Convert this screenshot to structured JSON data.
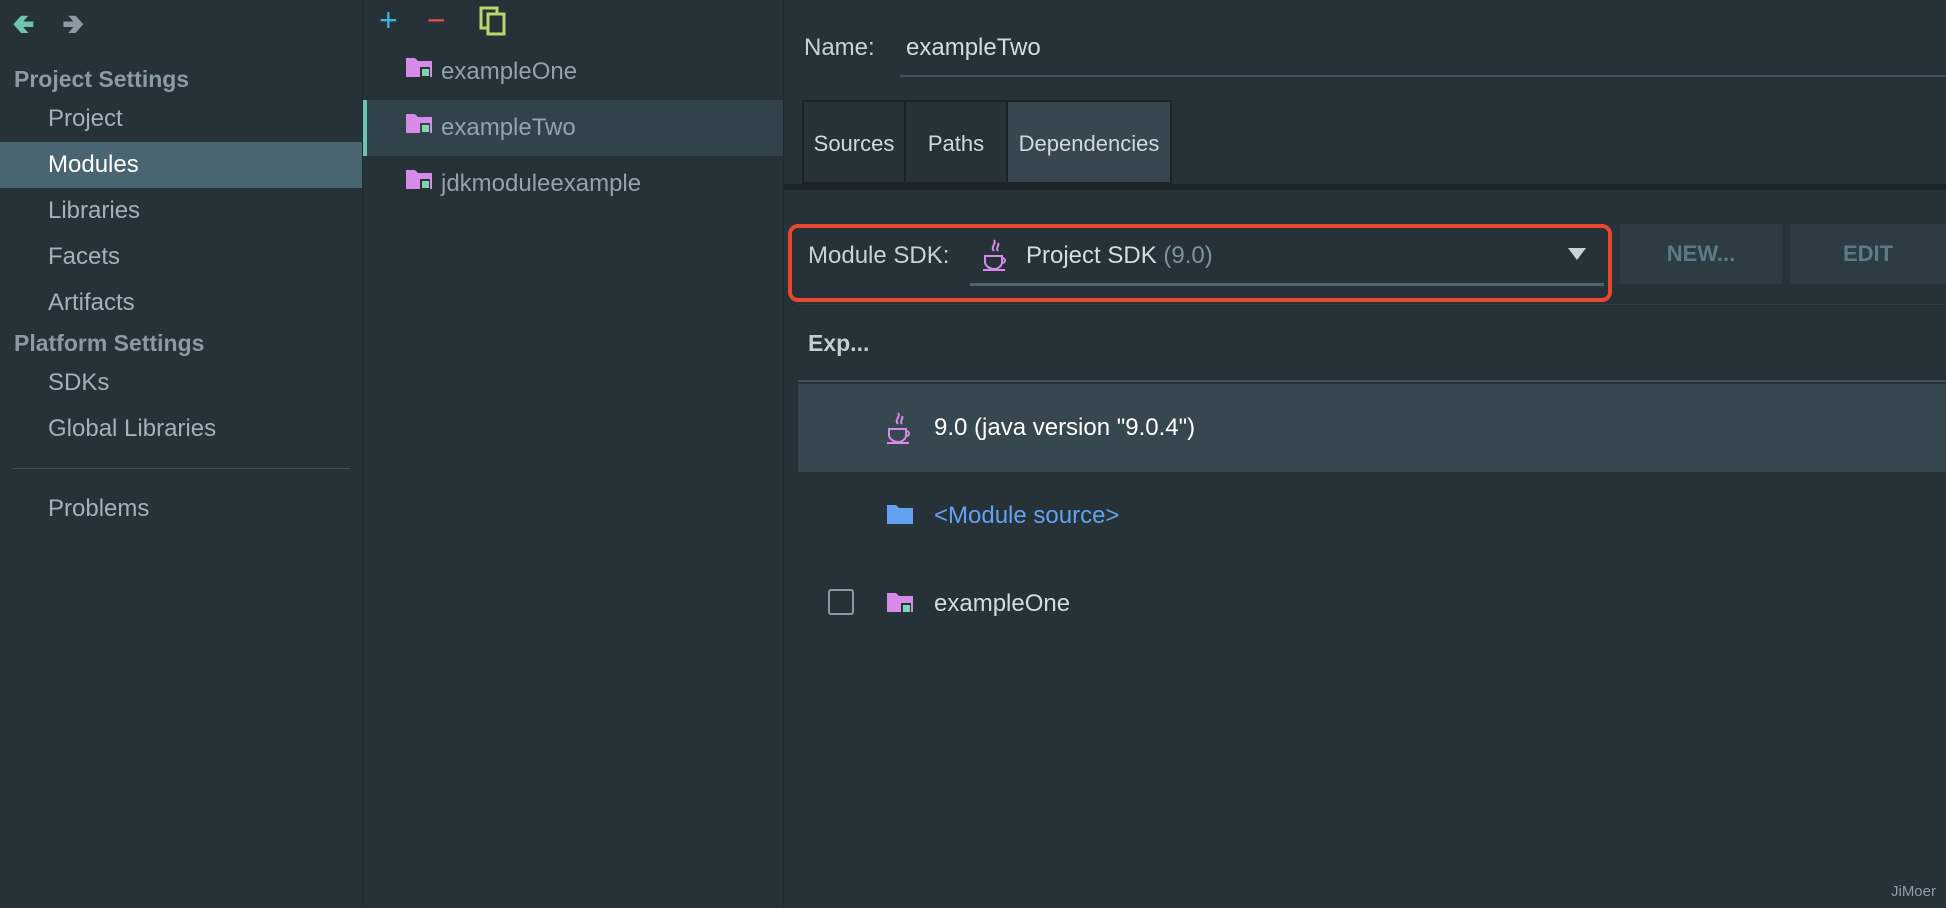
{
  "nav": {
    "project_settings_title": "Project Settings",
    "project_items": [
      "Project",
      "Modules",
      "Libraries",
      "Facets",
      "Artifacts"
    ],
    "platform_settings_title": "Platform Settings",
    "platform_items": [
      "SDKs",
      "Global Libraries"
    ],
    "problems_label": "Problems",
    "selected": "Modules"
  },
  "toolbar": {
    "add_symbol": "+",
    "remove_symbol": "−"
  },
  "modules": [
    "exampleOne",
    "exampleTwo",
    "jdkmoduleexample"
  ],
  "selected_module": "exampleTwo",
  "content": {
    "name_label": "Name:",
    "name_value": "exampleTwo",
    "tabs": [
      "Sources",
      "Paths",
      "Dependencies"
    ],
    "active_tab": "Dependencies",
    "module_sdk_label": "Module SDK:",
    "sdk_name": "Project SDK",
    "sdk_version": "(9.0)",
    "new_button": "NEW...",
    "edit_button": "EDIT",
    "export_header": "Exp...",
    "dependencies": [
      {
        "label": "9.0 (java version \"9.0.4\")",
        "icon": "java-icon"
      },
      {
        "label": "<Module source>",
        "icon": "folder-icon"
      },
      {
        "label": "exampleOne",
        "icon": "module-folder-icon"
      }
    ]
  },
  "colors": {
    "accent_red": "#e8472f",
    "selection": "#4a6572",
    "link_blue": "#63a2f0",
    "module_folder": "#d68be8"
  },
  "watermark": "JiMoer"
}
